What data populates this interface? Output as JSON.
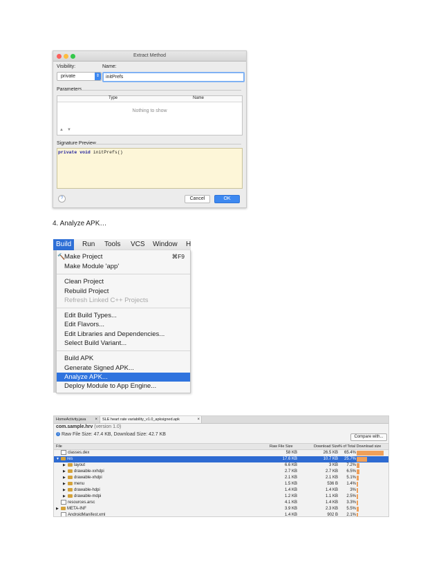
{
  "dialog": {
    "title": "Extract Method",
    "visibility_label": "Visibility:",
    "visibility_value": "private",
    "name_label": "Name:",
    "name_value": "initPrefs",
    "parameters_label": "Parameters",
    "columns": [
      "Type",
      "Name"
    ],
    "empty_message": "Nothing to show",
    "signature_label": "Signature Preview",
    "signature_keywords": "private void",
    "signature_rest": " initPrefs()",
    "help_label": "?",
    "cancel_label": "Cancel",
    "ok_label": "OK",
    "move_up_glyph": "▲",
    "move_down_glyph": "▼",
    "colors": {
      "accent": "#3d88f0",
      "close": "#fc605c",
      "minimize": "#fdbc40",
      "zoom": "#34c84a"
    }
  },
  "step_label": "4. Analyze APK…",
  "menubar": {
    "items": [
      "Build",
      "Run",
      "Tools",
      "VCS",
      "Window",
      "H"
    ],
    "active": "Build"
  },
  "build_menu": {
    "make_project": "Make Project",
    "make_project_shortcut": "⌘F9",
    "make_module": "Make Module 'app'",
    "clean_project": "Clean Project",
    "rebuild_project": "Rebuild Project",
    "refresh_linked": "Refresh Linked C++ Projects",
    "edit_build_types": "Edit Build Types...",
    "edit_flavors": "Edit Flavors...",
    "edit_libraries": "Edit Libraries and Dependencies...",
    "select_variant": "Select Build Variant...",
    "build_apk": "Build APK",
    "generate_signed": "Generate Signed APK...",
    "analyze_apk": "Analyze APK...",
    "deploy_module": "Deploy Module to App Engine...",
    "hammer_icon": "hammer-icon",
    "highlight_color": "#2f73de"
  },
  "apk_analyzer": {
    "tabs": [
      "HomeActivity.java",
      "SLE heart rate variability_v1.0_apksigned.apk"
    ],
    "package": "com.sample.hrv",
    "version": "(version 1.0)",
    "sizes_text": "Raw File Size: 47.4 KB, Download Size: 42.7 KB",
    "compare_label": "Compare with...",
    "columns": [
      "File",
      "Raw File Size",
      "Download Size",
      "% of Total Download size"
    ],
    "rows": [
      {
        "name": "classes.dex",
        "raw": "58 KB",
        "download": "26.5 KB",
        "percent": "65.4%",
        "pct": 65.4,
        "depth": 0,
        "arrow": "",
        "folder": false,
        "selected": false
      },
      {
        "name": "res",
        "raw": "17.6 KB",
        "download": "10.7 KB",
        "percent": "25.7%",
        "pct": 25.7,
        "depth": 0,
        "arrow": "▼",
        "folder": true,
        "selected": true
      },
      {
        "name": "layout",
        "raw": "6.6 KB",
        "download": "3 KB",
        "percent": "7.2%",
        "pct": 7.2,
        "depth": 1,
        "arrow": "▶",
        "folder": true,
        "selected": false
      },
      {
        "name": "drawable-xxhdpi",
        "raw": "2.7 KB",
        "download": "2.7 KB",
        "percent": "6.5%",
        "pct": 6.5,
        "depth": 1,
        "arrow": "▶",
        "folder": true,
        "selected": false
      },
      {
        "name": "drawable-xhdpi",
        "raw": "2.1 KB",
        "download": "2.1 KB",
        "percent": "5.1%",
        "pct": 5.1,
        "depth": 1,
        "arrow": "▶",
        "folder": true,
        "selected": false
      },
      {
        "name": "menu",
        "raw": "1.5 KB",
        "download": "536 B",
        "percent": "1.4%",
        "pct": 1.4,
        "depth": 1,
        "arrow": "▶",
        "folder": true,
        "selected": false
      },
      {
        "name": "drawable-hdpi",
        "raw": "1.4 KB",
        "download": "1.4 KB",
        "percent": "3%",
        "pct": 3,
        "depth": 1,
        "arrow": "▶",
        "folder": true,
        "selected": false
      },
      {
        "name": "drawable-mdpi",
        "raw": "1.2 KB",
        "download": "1.1 KB",
        "percent": "2.5%",
        "pct": 2.5,
        "depth": 1,
        "arrow": "▶",
        "folder": true,
        "selected": false
      },
      {
        "name": "resources.arsc",
        "raw": "4.1 KB",
        "download": "1.4 KB",
        "percent": "3.3%",
        "pct": 3.3,
        "depth": 0,
        "arrow": "",
        "folder": false,
        "selected": false
      },
      {
        "name": "META-INF",
        "raw": "3.9 KB",
        "download": "2.3 KB",
        "percent": "5.5%",
        "pct": 5.5,
        "depth": 0,
        "arrow": "▶",
        "folder": true,
        "selected": false
      },
      {
        "name": "AndroidManifest.xml",
        "raw": "1.4 KB",
        "download": "902 B",
        "percent": "2.1%",
        "pct": 2.1,
        "depth": 0,
        "arrow": "",
        "folder": false,
        "selected": false
      }
    ],
    "bar_color": "#f0a05a"
  }
}
